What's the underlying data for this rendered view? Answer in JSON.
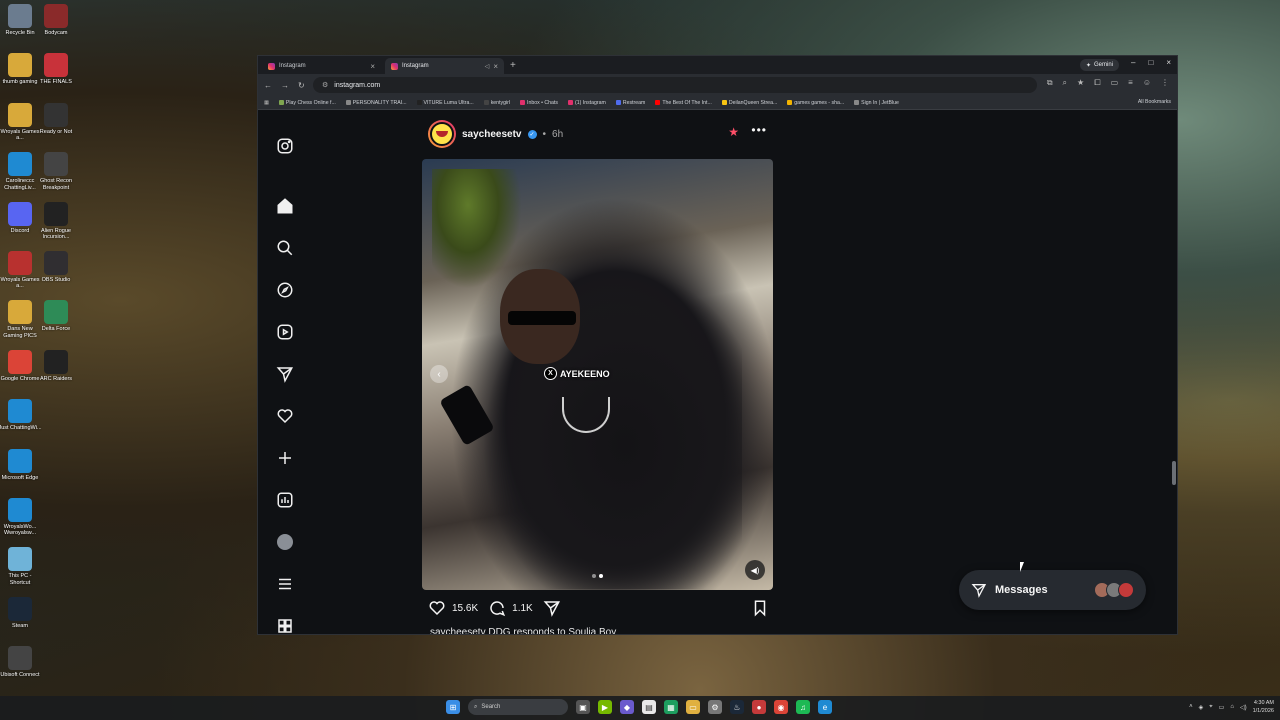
{
  "desktop": {
    "col1": [
      {
        "label": "Recycle Bin",
        "icon": "recycle-bin-icon",
        "color": "#6b7c8f"
      },
      {
        "label": "thumb gaming",
        "icon": "folder-icon",
        "color": "#d8a93a"
      },
      {
        "label": "Wroyals Games a...",
        "icon": "folder-icon",
        "color": "#d8a93a"
      },
      {
        "label": "Carolineccc ChattingLiv...",
        "icon": "edge-icon",
        "color": "#1f8ad2"
      },
      {
        "label": "Discord",
        "icon": "discord-icon",
        "color": "#5865f2"
      },
      {
        "label": "Wroyals Games a...",
        "icon": "folder-icon",
        "color": "#b8312f"
      },
      {
        "label": "Dans New Gaming PICS",
        "icon": "folder-icon",
        "color": "#d8a93a"
      },
      {
        "label": "Google Chrome",
        "icon": "chrome-icon",
        "color": "#db4437"
      },
      {
        "label": "Just ChattingWi...",
        "icon": "edge-icon",
        "color": "#1f8ad2"
      },
      {
        "label": "Microsoft Edge",
        "icon": "edge-icon",
        "color": "#1f8ad2"
      },
      {
        "label": "WroyalsWo... Wwroyalsw...",
        "icon": "edge-icon",
        "color": "#1f8ad2"
      },
      {
        "label": "This PC - Shortcut",
        "icon": "pc-icon",
        "color": "#6fb3d8"
      },
      {
        "label": "Steam",
        "icon": "steam-icon",
        "color": "#1b2838"
      },
      {
        "label": "Ubisoft Connect",
        "icon": "ubisoft-icon",
        "color": "#444444"
      }
    ],
    "col2": [
      {
        "label": "Bodycam",
        "icon": "bodycam-icon",
        "color": "#8a2a2a"
      },
      {
        "label": "THE FINALS",
        "icon": "finals-icon",
        "color": "#c8323a"
      },
      {
        "label": "Ready or Not",
        "icon": "readyornot-icon",
        "color": "#333333"
      },
      {
        "label": "Ghost Recon Breakpoint",
        "icon": "ghostrecon-icon",
        "color": "#444444"
      },
      {
        "label": "Alien Rogue Incursion...",
        "icon": "alien-icon",
        "color": "#222222"
      },
      {
        "label": "OBS Studio",
        "icon": "obs-icon",
        "color": "#302e31"
      },
      {
        "label": "Delta Force",
        "icon": "deltaforce-icon",
        "color": "#2e8b57"
      },
      {
        "label": "ARC Raiders",
        "icon": "arc-raiders-icon",
        "color": "#222222"
      }
    ]
  },
  "browser": {
    "tabs": [
      {
        "title": "Instagram",
        "close": "×"
      },
      {
        "title": "Instagram",
        "close": "×"
      }
    ],
    "new_tab": "+",
    "gemini_label": "Gemini",
    "window_controls": {
      "minimize": "–",
      "maximize": "□",
      "close": "×"
    },
    "nav": {
      "back": "←",
      "forward": "→",
      "reload": "↻"
    },
    "url": "instagram.com",
    "bookmarks": [
      {
        "label": "Play Chess Online f...",
        "color": "#7fa650"
      },
      {
        "label": "PERSONALITY TRAI...",
        "color": "#888888"
      },
      {
        "label": "VITURE Luma Ultra...",
        "color": "#222222"
      },
      {
        "label": "kentygirl",
        "color": "#444444"
      },
      {
        "label": "Inbox • Chats",
        "color": "#e1306c"
      },
      {
        "label": "(1) Instagram",
        "color": "#e1306c"
      },
      {
        "label": "Restream",
        "color": "#4f6bed"
      },
      {
        "label": "The Best Of The Int...",
        "color": "#ff0000"
      },
      {
        "label": "DeilanQueen Strea...",
        "color": "#f9c513"
      },
      {
        "label": "games games - sha...",
        "color": "#f4b400"
      },
      {
        "label": "Sign In | JetBlue",
        "color": "#888888"
      }
    ],
    "all_bookmarks": "All Bookmarks"
  },
  "instagram": {
    "post": {
      "username": "saycheesetv",
      "separator": "•",
      "time": "6h",
      "watermark": "AYEKEENO",
      "likes": "15.6K",
      "comments": "1.1K",
      "caption": "saycheesetv DDG responds to Soulja Boy"
    },
    "messages_label": "Messages",
    "message_avatar_colors": [
      "#a36b5a",
      "#7a7a7a",
      "#c43a3a"
    ]
  },
  "taskbar": {
    "search_label": "Search",
    "time": "4:30 AM",
    "date": "1/1/2026"
  }
}
